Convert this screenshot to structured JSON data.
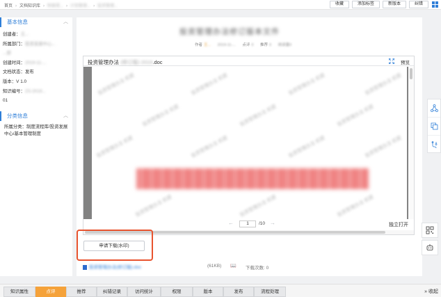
{
  "breadcrumb": {
    "items": [
      "首页",
      "文档知识库",
      "制度规...",
      "计划管理...",
      "投资管理..."
    ]
  },
  "top_actions": {
    "favorite": "收藏",
    "add_tag": "添加标签",
    "new_version": "新版本",
    "correct": "纠错"
  },
  "basic_info": {
    "header": "基本信息",
    "creator_label": "创建者：",
    "creator_value": "王...",
    "dept_label": "所属部门：",
    "dept_value": "投资发展中心...",
    "dept_value2": "...部",
    "created_label": "创建时间：",
    "created_value": "2019-11-...",
    "status_label": "文档状态：",
    "status_value": "发布",
    "version_label": "版本：",
    "version_value": "V 1.0",
    "code_label": "知识编号：",
    "code_value": "ZS-2019...",
    "code_value2": "01"
  },
  "category_info": {
    "header": "分类信息",
    "text": "所属分类：制度流程库/投资发展中心/基本管理制度"
  },
  "document": {
    "title": "投资管理办法修订版本文件",
    "meta_author_label": "作者",
    "meta_author": "王...",
    "meta_date": "2019-11-...",
    "meta_clicks_label": "点评",
    "meta_clicks": "0",
    "meta_recommend_label": "推荐",
    "meta_recommend": "0",
    "meta_readers": "阅读量0"
  },
  "viewer": {
    "file_prefix": "投资管理办法",
    "file_blur": "(修订版) 2019",
    "file_ext": ".doc",
    "preview_label": "预览",
    "page_current": "1",
    "page_total": "/10",
    "standalone_open": "独立打开",
    "watermark": "投资管理办法 机密"
  },
  "apply_download": "申请下载(水印)",
  "attachment": {
    "name": "投资管理办法(修订版).doc",
    "size": "(61KB)",
    "download_count": "下载次数: 0"
  },
  "tabs": [
    "知识属性",
    "点评",
    "推荐",
    "纠错记录",
    "访问统计",
    "权限",
    "版本",
    "发布",
    "流程处理"
  ],
  "collapse_label": "收起"
}
